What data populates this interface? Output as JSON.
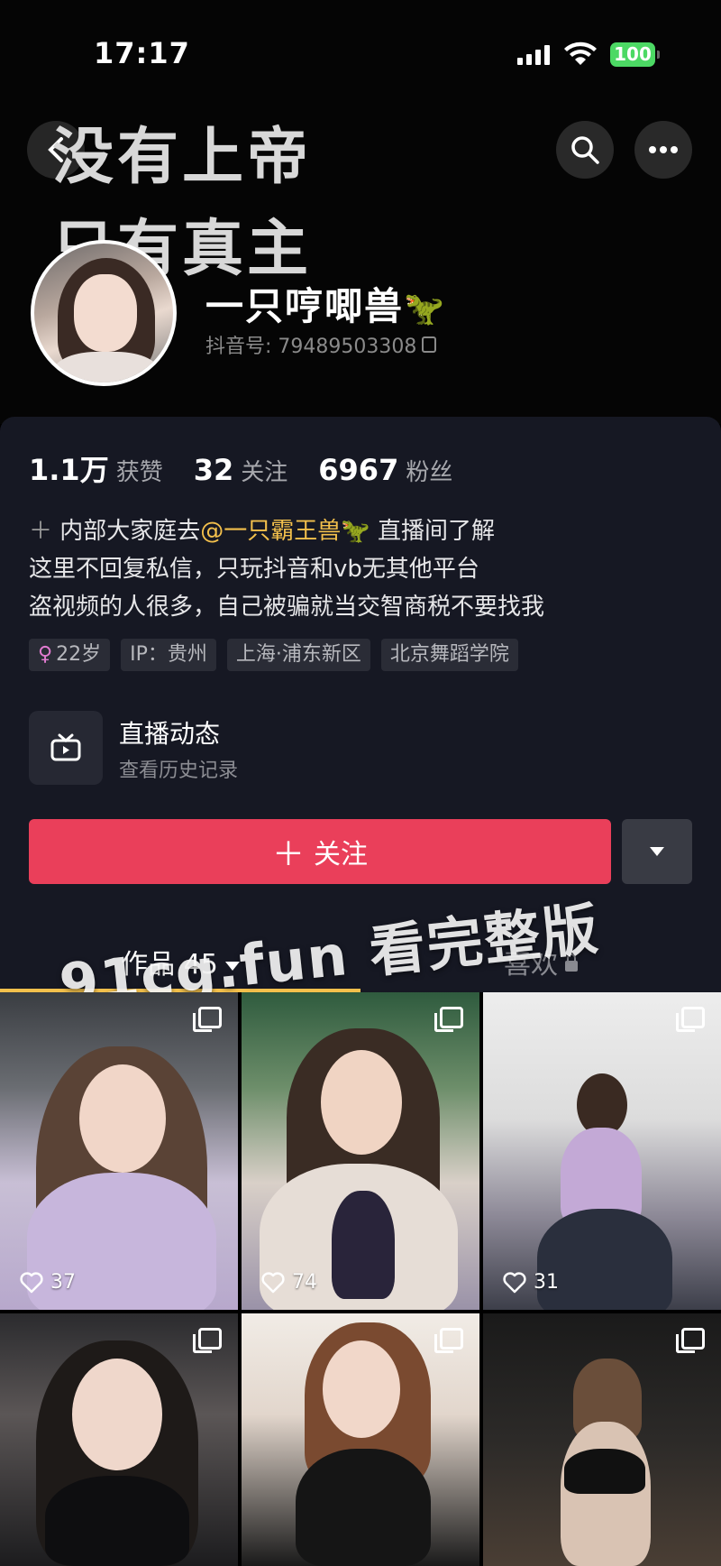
{
  "status_bar": {
    "time": "17:17",
    "battery": "100"
  },
  "header": {
    "banner_line1": "没有上帝",
    "banner_line2": "只有真主",
    "nickname": "一只哼唧兽",
    "nickname_emoji": "🦖",
    "douyin_id": "抖音号: 79489503308"
  },
  "stats": [
    {
      "num": "1.1万",
      "label": "获赞"
    },
    {
      "num": "32",
      "label": "关注"
    },
    {
      "num": "6967",
      "label": "粉丝"
    }
  ],
  "bio": {
    "line1_prefix": "内部大家庭去",
    "line1_mention": "@一只霸王兽",
    "line1_emoji": "🦖",
    "line1_suffix": "直播间了解",
    "line2": "这里不回复私信，只玩抖音和vb无其他平台",
    "line3": "盗视频的人很多，自己被骗就当交智商税不要找我"
  },
  "tags": {
    "gender_symbol": "♀",
    "age": "22岁",
    "ip": "IP：贵州",
    "location": "上海·浦东新区",
    "school": "北京舞蹈学院"
  },
  "live": {
    "title": "直播动态",
    "subtitle": "查看历史记录"
  },
  "follow_button": {
    "label": "关注"
  },
  "tabs": {
    "works": "作品 45",
    "likes": "喜欢"
  },
  "posts": [
    {
      "likes": "37"
    },
    {
      "likes": "74"
    },
    {
      "likes": "31"
    },
    {
      "likes": ""
    },
    {
      "likes": ""
    },
    {
      "likes": ""
    }
  ],
  "watermark": "91cg.fun 看完整版",
  "colors": {
    "accent": "#ea3f5a",
    "tab_indicator": "#f3c04c",
    "mention": "#f3c04c",
    "panel": "#161823"
  }
}
